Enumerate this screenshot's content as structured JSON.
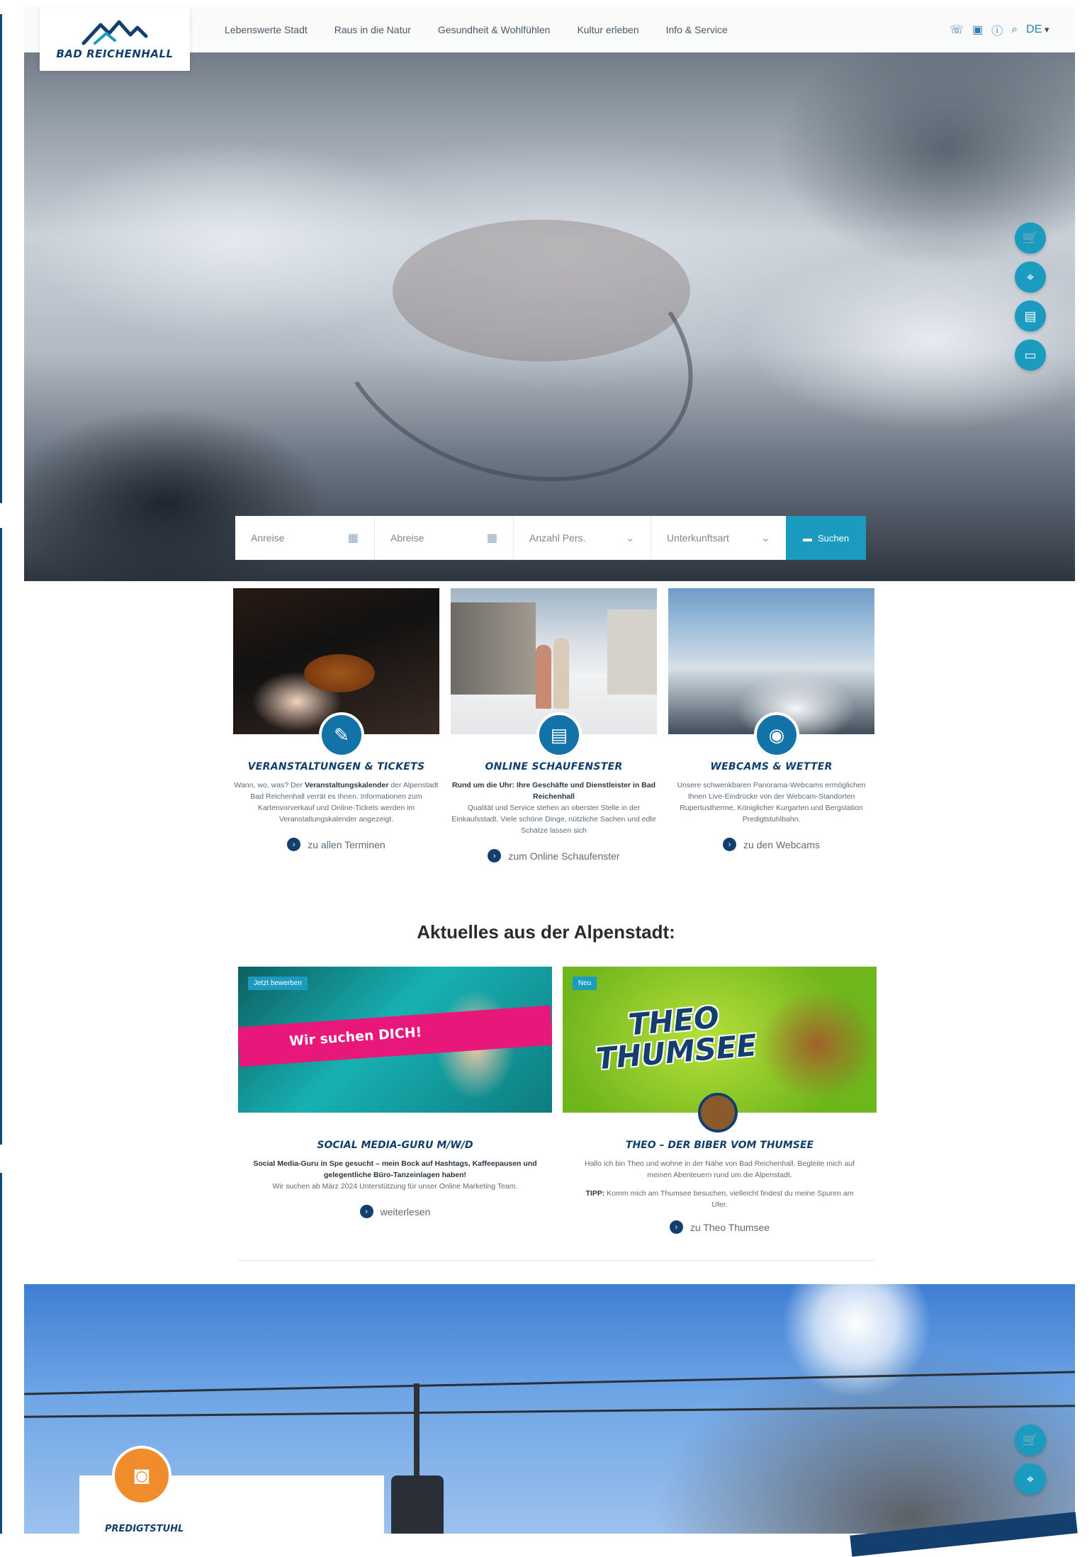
{
  "brand": {
    "logo_text": "BAD REICHENHALL"
  },
  "nav": {
    "items": [
      "Lebenswerte Stadt",
      "Raus in die Natur",
      "Gesundheit & Wohlfühlen",
      "Kultur erleben",
      "Info & Service"
    ]
  },
  "tools": {
    "lang": "DE",
    "icons": [
      "phone-icon",
      "bus-icon",
      "info-icon",
      "search-icon"
    ]
  },
  "fabs": [
    "cart-icon",
    "location-icon",
    "storefront-icon",
    "book-icon"
  ],
  "booking": {
    "arrival": "Anreise",
    "departure": "Abreise",
    "persons": "Anzahl Pers.",
    "accommodation": "Unterkunftsart",
    "search": "Suchen"
  },
  "cards": [
    {
      "title": "VERANSTALTUNGEN & TICKETS",
      "text_pre": "Wann, wo, was? Der ",
      "text_bold": "Veranstaltungskalender",
      "text_post": " der Alpenstadt Bad Reichenhall verrät es Ihnen. Informationen zum Kartenvorverkauf und Online-Tickets werden im Veranstaltungskalender angezeigt.",
      "link": "zu allen Terminen",
      "icon": "ticket-icon"
    },
    {
      "title": "ONLINE SCHAUFENSTER",
      "text_bold": "Rund um die Uhr: Ihre Geschäfte und Dienstleister in Bad Reichenhall",
      "text_post": "Qualität und Service stehen an oberster Stelle in der Einkaufsstadt. Viele schöne Dinge, nützliche Sachen und edle Schätze lassen sich",
      "link": "zum Online Schaufenster",
      "icon": "storefront-icon"
    },
    {
      "title": "WEBCAMS & WETTER",
      "text_post": "Unsere schwenkbaren Panorama-Webcams ermöglichen Ihnen Live-Eindrücke von der Webcam-Standorten Rupertustherme, Königlicher Kurgarten und Bergstation Predigtstuhlbahn.",
      "link": "zu den Webcams",
      "icon": "webcam-icon"
    }
  ],
  "news_title": "Aktuelles aus der Alpenstadt:",
  "news": [
    {
      "tag": "Jetzt bewerben",
      "banner": "Wir suchen DICH!",
      "title": "SOCIAL MEDIA-GURU M/W/D",
      "text_bold": "Social Media-Guru in Spe gesucht – mein Bock auf Hashtags, Kaffeepausen und gelegentliche Büro-Tanzeinlagen haben!",
      "text_post": "Wir suchen ab März 2024 Unterstützung für unser Online Marketing Team.",
      "link": "weiterlesen"
    },
    {
      "tag": "Neu",
      "banner_line1": "THEO",
      "banner_line2": "THUMSEE",
      "title": "THEO – DER BIBER VOM THUMSEE",
      "text_post": "Hallo ich bin Theo und wohne in der Nähe von Bad Reichenhall. Begleite mich auf meinen Abenteuern rund um die Alpenstadt.",
      "tip_bold": "TIPP:",
      "tip_text": " Komm mich am Thumsee besuchen, vielleicht findest du meine Spuren am Ufer.",
      "link": "zu Theo Thumsee"
    }
  ],
  "photo": {
    "label": "PREDIGTSTUHL"
  },
  "colors": {
    "primary": "#1372a8",
    "navy": "#123f6e",
    "accent": "#1c9bc0",
    "orange": "#f08c2c"
  }
}
